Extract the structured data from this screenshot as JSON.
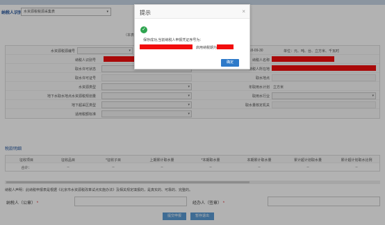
{
  "taxpayer_bar": {
    "label": "纳税人识别号",
    "selected": "水资源税税源采集表"
  },
  "hints": {
    "center_left": "（本表",
    "center_right": "填报）"
  },
  "form": {
    "row1": {
      "label": "水资源税源编号",
      "date": "2018-09-30",
      "unit": "单位：元、吨、台、立方米、千瓦时"
    },
    "row2": {
      "left": "纳税人识别号",
      "right": "纳税人名称"
    },
    "row3": {
      "left": "取水许可状态",
      "right": "纳税人所在地"
    },
    "row4": {
      "left": "取水许可证号",
      "right": "取水地点"
    },
    "row5": {
      "left": "水资源类型",
      "right": "年取用水计划",
      "right_value": "立方米"
    },
    "row6": {
      "left": "地下水取水地点水资源税规划量",
      "right": "取用水行业"
    },
    "row7": {
      "left": "地下超采区类型",
      "right": "取水量核定机关"
    },
    "row8": {
      "left": "适用税额标准"
    }
  },
  "section_title": "税款明细",
  "table": {
    "headers": [
      "征收项目",
      "征收品目",
      "*征收子目",
      "上期累计取水量",
      "*本期取水量",
      "本期累计取水量",
      "累计超计划取水量",
      "累计超计划取水比例"
    ],
    "row": [
      "合计：",
      "--",
      "--",
      "--",
      "--",
      "--",
      "--",
      "--"
    ]
  },
  "note": "纳税人声明：此纳税申报表是根据《北京市水资源税改革试点实施办法》及相关规定填报的，是真实的、可靠的、完整的。",
  "signature": {
    "taxpayer": "纳税人（公章）",
    "agent": "经办人（签章）",
    "required": "*"
  },
  "bottom_buttons": {
    "submit": "提交申报",
    "cancel": "暂存退出"
  },
  "dialog": {
    "title": "提示",
    "close": "×",
    "line1": "保存成功,当前纳税人申报凭证序号为：",
    "line2": "启用纳税期为",
    "confirm": "确定"
  }
}
